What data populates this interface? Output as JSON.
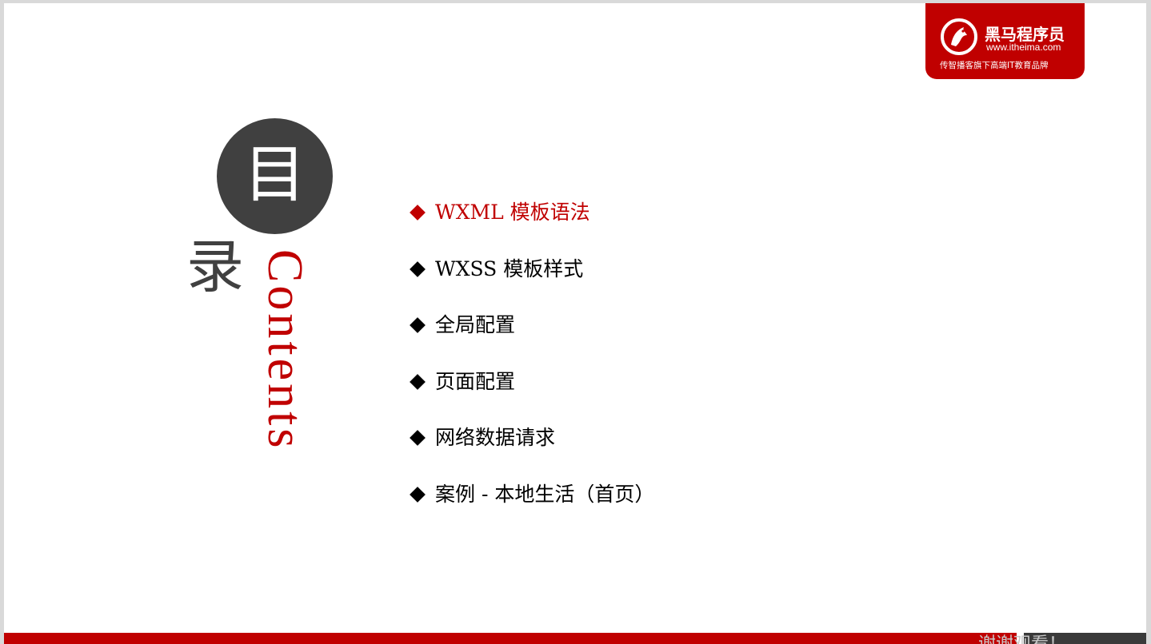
{
  "logo": {
    "name": "黑马程序员",
    "url": "www.itheima.com",
    "tagline": "传智播客旗下高端IT教育品牌"
  },
  "title": {
    "circle_char": "目",
    "second_char": "录",
    "english": "Contents"
  },
  "menu": {
    "items": [
      {
        "label": "WXML 模板语法",
        "active": true
      },
      {
        "label": "WXSS 模板样式",
        "active": false
      },
      {
        "label": "全局配置",
        "active": false
      },
      {
        "label": "页面配置",
        "active": false
      },
      {
        "label": "网络数据请求",
        "active": false
      },
      {
        "label": "案例 - 本地生活（首页）",
        "active": false
      }
    ]
  },
  "footer": {
    "text": "谢谢观看！"
  },
  "colors": {
    "accent": "#c00000",
    "dark": "#404040"
  }
}
